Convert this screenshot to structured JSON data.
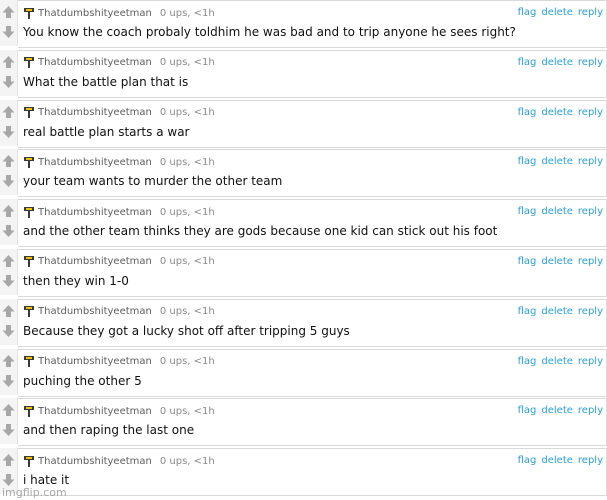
{
  "comments": [
    {
      "user": "Thatdumbshityeetman",
      "ups": "0 ups, <1h",
      "text": "You know the coach probaly toldhim he was bad and to trip anyone he sees right?"
    },
    {
      "user": "Thatdumbshityeetman",
      "ups": "0 ups, <1h",
      "text": "What the battle plan that is"
    },
    {
      "user": "Thatdumbshityeetman",
      "ups": "0 ups, <1h",
      "text": "real battle plan starts a war"
    },
    {
      "user": "Thatdumbshityeetman",
      "ups": "0 ups, <1h",
      "text": "your team wants to murder the other team"
    },
    {
      "user": "Thatdumbshityeetman",
      "ups": "0 ups, <1h",
      "text": "and the other team thinks they are gods because one kid can stick out his foot"
    },
    {
      "user": "Thatdumbshityeetman",
      "ups": "0 ups, <1h",
      "text": "then they win 1-0"
    },
    {
      "user": "Thatdumbshityeetman",
      "ups": "0 ups, <1h",
      "text": "Because they got a lucky shot off after tripping 5 guys"
    },
    {
      "user": "Thatdumbshityeetman",
      "ups": "0 ups, <1h",
      "text": "puching the other 5"
    },
    {
      "user": "Thatdumbshityeetman",
      "ups": "0 ups, <1h",
      "text": "and then raping the last one"
    },
    {
      "user": "Thatdumbshityeetman",
      "ups": "0 ups, <1h",
      "text": "i hate it"
    }
  ],
  "actions": {
    "flag": "flag",
    "delete": "delete",
    "reply": "reply"
  },
  "icons": {
    "upvote": "upvote-arrow-icon",
    "downvote": "downvote-arrow-icon",
    "flair": "flair-icon"
  },
  "colors": {
    "action_link": "#2a9fd6",
    "flair": "#333333"
  },
  "watermark": "imgflip.com"
}
